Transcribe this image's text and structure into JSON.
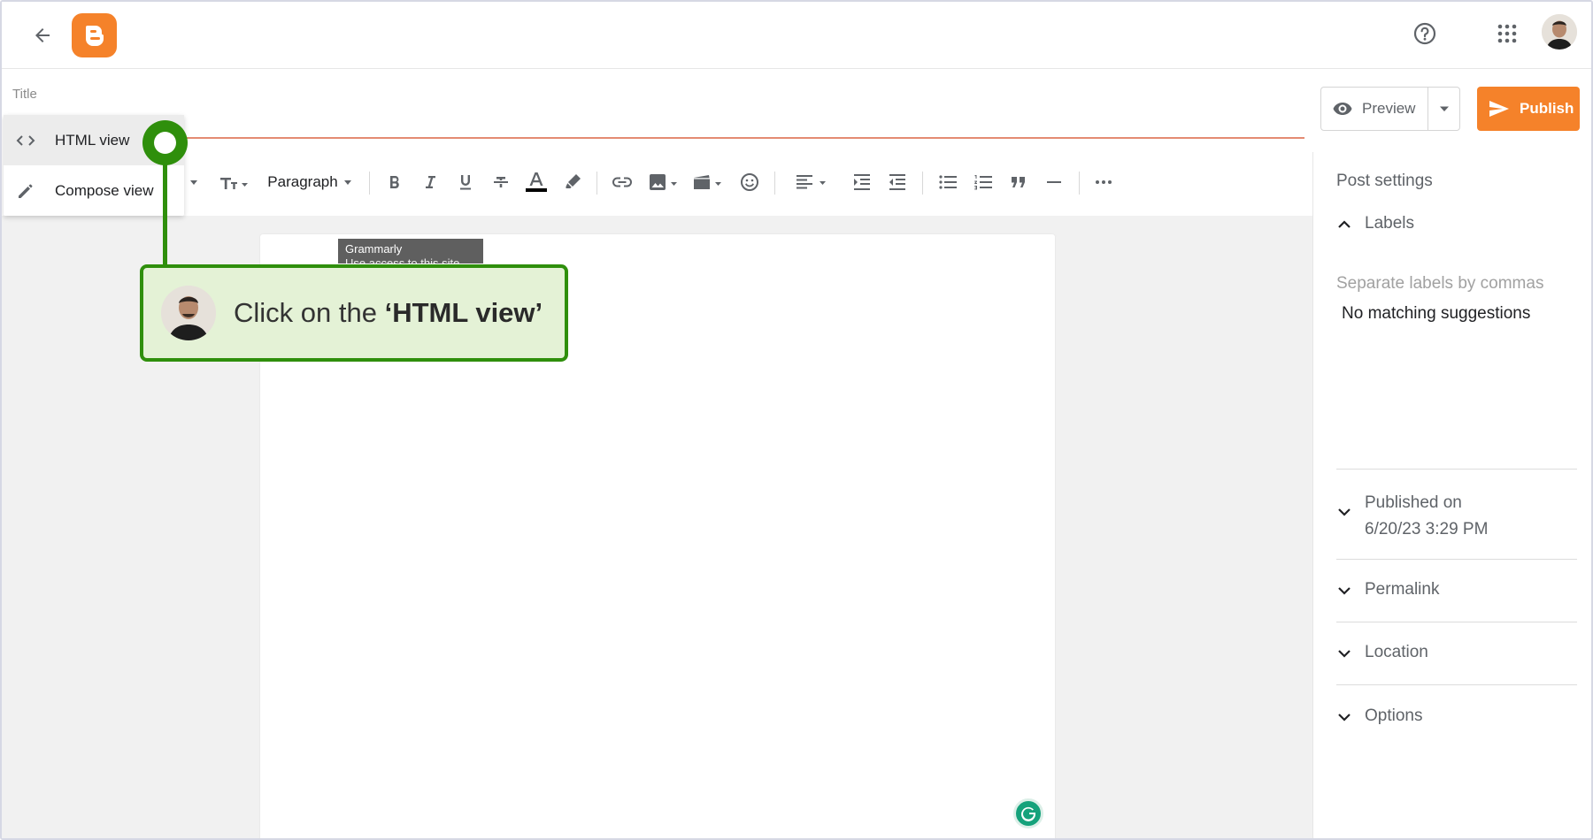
{
  "header": {
    "back_icon": "arrow-left-icon",
    "logo_icon": "blogger-logo-icon",
    "help_icon": "help-circle-icon",
    "apps_icon": "apps-grid-icon",
    "avatar_icon": "user-avatar"
  },
  "title": {
    "placeholder": "Title"
  },
  "actions": {
    "preview_label": "Preview",
    "publish_label": "Publish"
  },
  "toolbar": {
    "paragraph_label": "Paragraph",
    "text_color": "#000000"
  },
  "view_menu": {
    "items": [
      {
        "label": "HTML view",
        "icon": "code-icon"
      },
      {
        "label": "Compose view",
        "icon": "pencil-icon"
      }
    ]
  },
  "grammarly": {
    "tooltip_title": "Grammarly",
    "tooltip_sub": "Use access to this site"
  },
  "callout": {
    "prefix": "Click on the ",
    "highlight": "‘HTML view’"
  },
  "sidebar": {
    "title": "Post settings",
    "labels_header": "Labels",
    "labels_placeholder": "Separate labels by commas",
    "no_match": "No matching suggestions",
    "published_label": "Published on",
    "published_date": "6/20/23 3:29 PM",
    "permalink": "Permalink",
    "location": "Location",
    "options": "Options"
  },
  "colors": {
    "accent": "#f5822a",
    "callout_border": "#2f8f0c",
    "callout_bg": "#e4f2d6"
  }
}
